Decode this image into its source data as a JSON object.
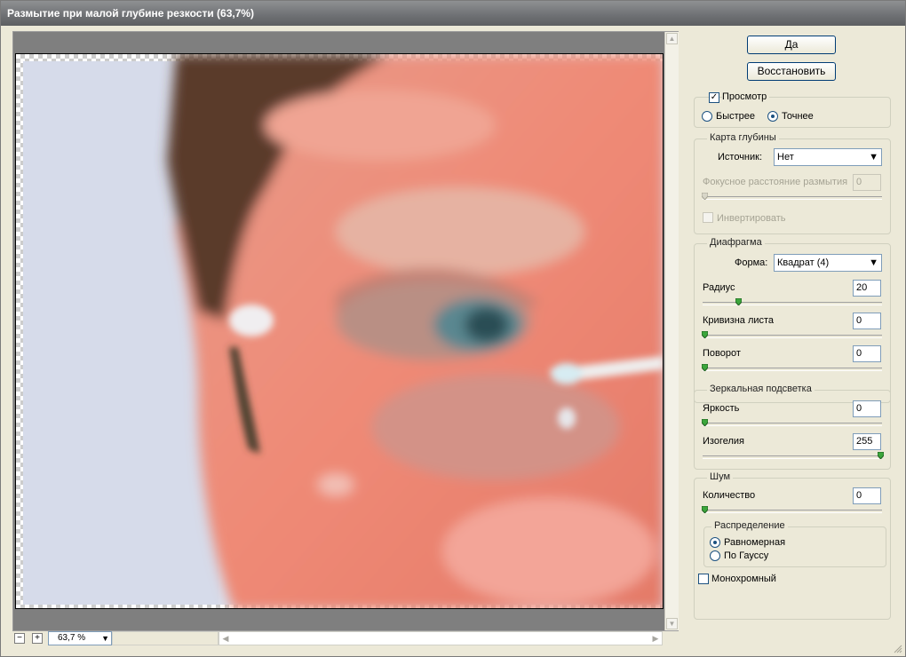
{
  "title": "Размытие при малой глубине резкости (63,7%)",
  "buttons": {
    "ok": "Да",
    "reset": "Восстановить"
  },
  "preview": {
    "checkbox_label": "Просмотр",
    "checked": true,
    "fast_label": "Быстрее",
    "accurate_label": "Точнее",
    "selected": "accurate"
  },
  "depth_map": {
    "legend": "Карта глубины",
    "source_label": "Источник:",
    "source_value": "Нет",
    "focal_label": "Фокусное расстояние размытия",
    "focal_value": "0",
    "invert_label": "Инвертировать"
  },
  "iris": {
    "legend": "Диафрагма",
    "shape_label": "Форма:",
    "shape_value": "Квадрат (4)",
    "radius_label": "Радиус",
    "radius_value": "20",
    "curvature_label": "Кривизна листа",
    "curvature_value": "0",
    "rotation_label": "Поворот",
    "rotation_value": "0"
  },
  "specular": {
    "legend": "Зеркальная подсветка",
    "brightness_label": "Яркость",
    "brightness_value": "0",
    "threshold_label": "Изогелия",
    "threshold_value": "255"
  },
  "noise": {
    "legend": "Шум",
    "amount_label": "Количество",
    "amount_value": "0",
    "distribution_legend": "Распределение",
    "uniform_label": "Равномерная",
    "gaussian_label": "По Гауссу",
    "selected": "uniform",
    "mono_label": "Монохромный"
  },
  "zoom": {
    "value": "63,7 %",
    "minus": "−",
    "plus": "+"
  },
  "icons": [
    "checkbox-icon",
    "radio-icon",
    "chevron-down-icon",
    "slider-thumb-icon",
    "scroll-up-icon",
    "scroll-down-icon",
    "scroll-left-icon",
    "scroll-right-icon",
    "resize-grip-icon"
  ]
}
